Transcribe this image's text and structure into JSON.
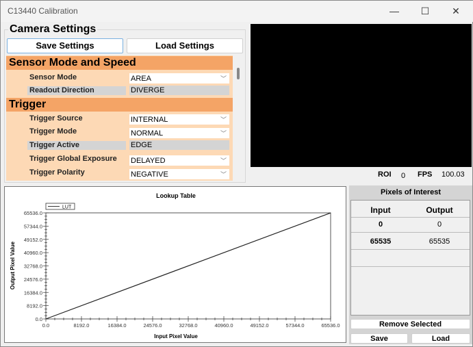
{
  "window": {
    "title": "C13440 Calibration",
    "minimize": "—",
    "maximize": "☐",
    "close": "✕"
  },
  "camera": {
    "title": "Camera Settings",
    "save_label": "Save Settings",
    "load_label": "Load Settings",
    "sections": [
      {
        "title": "Sensor Mode and Speed"
      },
      {
        "title": "Trigger"
      }
    ],
    "fields": [
      {
        "label": "Sensor Mode",
        "value": "AREA"
      },
      {
        "label": "Readout Direction",
        "value": "DIVERGE"
      },
      {
        "label": "Trigger Source",
        "value": "INTERNAL"
      },
      {
        "label": "Trigger Mode",
        "value": "NORMAL"
      },
      {
        "label": "Trigger Active",
        "value": "EDGE"
      },
      {
        "label": "Trigger Global Exposure",
        "value": "DELAYED"
      },
      {
        "label": "Trigger Polarity",
        "value": "NEGATIVE"
      }
    ]
  },
  "status": {
    "roi_label": "ROI",
    "roi_value": "0",
    "fps_label": "FPS",
    "fps_value": "100.03"
  },
  "chart_data": {
    "type": "line",
    "title": "Lookup Table",
    "xlabel": "Input Pixel Value",
    "ylabel": "Output Pixel Value",
    "xlim": [
      0,
      65536
    ],
    "ylim": [
      0,
      65536
    ],
    "xticks": [
      "0.0",
      "8192.0",
      "16384.0",
      "24576.0",
      "32768.0",
      "40960.0",
      "49152.0",
      "57344.0",
      "65536.0"
    ],
    "yticks": [
      "0.0",
      "8192.0",
      "16384.0",
      "24576.0",
      "32768.0",
      "40960.0",
      "49152.0",
      "57344.0",
      "65536.0"
    ],
    "legend": "top-left",
    "series": [
      {
        "name": "LUT",
        "x": [
          0,
          65535
        ],
        "y": [
          0,
          65535
        ]
      }
    ]
  },
  "pixels": {
    "title": "Pixels of Interest",
    "headers": [
      "Input",
      "Output"
    ],
    "rows": [
      {
        "input": "0",
        "output": "0"
      },
      {
        "input": "65535",
        "output": "65535"
      }
    ],
    "remove_label": "Remove Selected",
    "save_label": "Save",
    "load_label": "Load"
  }
}
